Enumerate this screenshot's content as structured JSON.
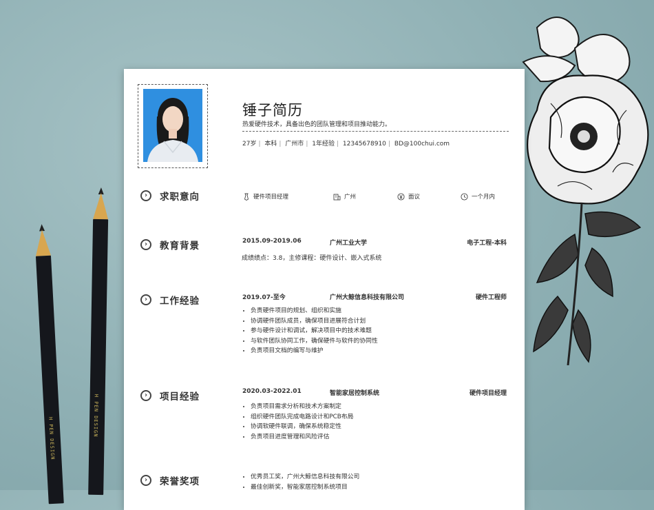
{
  "resume": {
    "name": "锤子简历",
    "motto": "热爱硬件技术，具备出色的团队管理和项目推动能力。",
    "info": [
      "27岁",
      "本科",
      "广州市",
      "1年经验",
      "12345678910",
      "BD@100chui.com"
    ]
  },
  "sections": {
    "intent": {
      "title": "求职意向",
      "items": [
        {
          "icon": "tie-icon",
          "label": "硬件项目经理"
        },
        {
          "icon": "building-icon",
          "label": "广州"
        },
        {
          "icon": "yen-icon",
          "label": "面议"
        },
        {
          "icon": "clock-icon",
          "label": "一个月内"
        }
      ]
    },
    "education": {
      "title": "教育背景",
      "date": "2015.09-2019.06",
      "school": "广州工业大学",
      "degree": "电子工程-本科",
      "detail": "成绩绩点：3.8，主修课程：硬件设计、嵌入式系统"
    },
    "work": {
      "title": "工作经验",
      "date": "2019.07-至今",
      "company": "广州大鲸信息科技有限公司",
      "role": "硬件工程师",
      "bullets": [
        "负责硬件项目的规划、组织和实施",
        "协调硬件团队成员，确保项目进展符合计划",
        "参与硬件设计和调试，解决项目中的技术难题",
        "与软件团队协同工作，确保硬件与软件的协同性",
        "负责项目文档的编写与维护"
      ]
    },
    "project": {
      "title": "项目经验",
      "date": "2020.03-2022.01",
      "name": "智能家居控制系统",
      "role": "硬件项目经理",
      "bullets": [
        "负责项目需求分析和技术方案制定",
        "组织硬件团队完成电路设计和PCB布局",
        "协调软硬件联调，确保系统稳定性",
        "负责项目进度管理和风险评估"
      ]
    },
    "honors": {
      "title": "荣誉奖项",
      "bullets": [
        "优秀员工奖，广州大鲸信息科技有限公司",
        "最佳创新奖，智能家居控制系统项目"
      ]
    }
  },
  "pencils": [
    {
      "brand": "H  PEN DESIGN"
    },
    {
      "brand": "H  PEN DESIGN"
    }
  ],
  "colors": {
    "background": "#8eaeb2",
    "paper": "#ffffff",
    "photo_bg": "#2f8fe0",
    "text": "#333333"
  }
}
